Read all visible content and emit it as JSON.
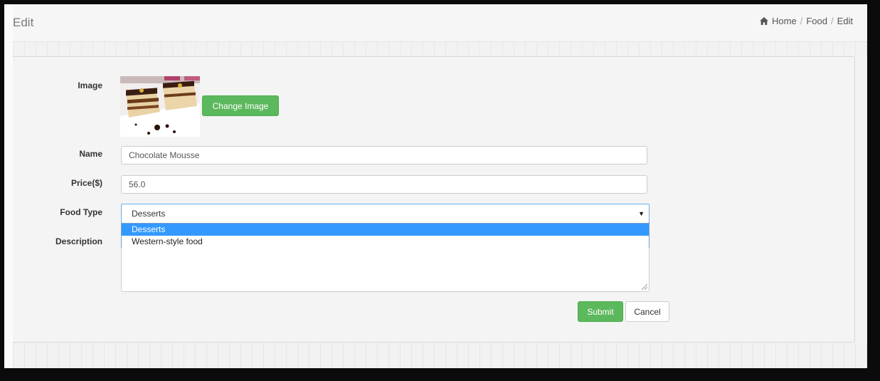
{
  "header": {
    "title": "Edit",
    "breadcrumb": [
      "Home",
      "Food",
      "Edit"
    ],
    "breadcrumb_separator": "/"
  },
  "form": {
    "image_label": "Image",
    "change_image_button": "Change Image",
    "name_label": "Name",
    "name_value": "Chocolate Mousse",
    "price_label": "Price($)",
    "price_value": "56.0",
    "food_type_label": "Food Type",
    "food_type_selected": "Desserts",
    "food_type_options": [
      "Desserts",
      "Western-style food"
    ],
    "description_label": "Description",
    "description_value": "",
    "submit_button": "Submit",
    "cancel_button": "Cancel"
  },
  "colors": {
    "accent_green": "#5cb85c",
    "selection_blue": "#3399ff"
  },
  "icons": {
    "home": "home-icon",
    "caret": "caret-down-icon"
  }
}
